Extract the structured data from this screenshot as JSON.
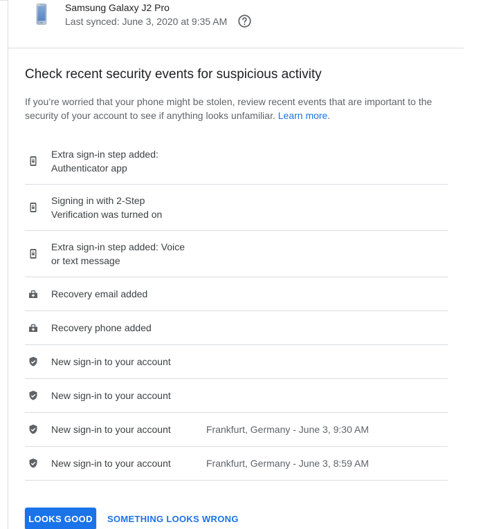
{
  "device": {
    "name": "Samsung Galaxy J2 Pro",
    "last_synced": "Last synced: June 3, 2020 at 9:35 AM",
    "phone_icon": "phone-image",
    "help_icon": "help-circle-icon"
  },
  "security_events": {
    "title": "Check recent security events for suspicious activity",
    "description": "If you’re worried that your phone might be stolen, review recent events that are important to the security of your account to see if anything looks unfamiliar.",
    "learn_more": "Learn more",
    "events": [
      {
        "icon": "phone-lock-icon",
        "label": "Extra sign-in step added: Authenticator app",
        "detail": ""
      },
      {
        "icon": "phone-lock-icon",
        "label": "Signing in with 2-Step Verification was turned on",
        "detail": ""
      },
      {
        "icon": "phone-lock-icon",
        "label": "Extra sign-in step added: Voice or text message",
        "detail": ""
      },
      {
        "icon": "recovery-icon",
        "label": "Recovery email added",
        "detail": ""
      },
      {
        "icon": "recovery-icon",
        "label": "Recovery phone added",
        "detail": ""
      },
      {
        "icon": "shield-check-icon",
        "label": "New sign-in to your account",
        "detail": ""
      },
      {
        "icon": "shield-check-icon",
        "label": "New sign-in to your account",
        "detail": ""
      },
      {
        "icon": "shield-check-icon",
        "label": "New sign-in to your account",
        "detail": "Frankfurt, Germany - June 3, 9:30 AM"
      },
      {
        "icon": "shield-check-icon",
        "label": "New sign-in to your account",
        "detail": "Frankfurt, Germany - June 3, 8:59 AM"
      }
    ]
  },
  "actions": {
    "looks_good": "LOOKS GOOD",
    "looks_wrong": "SOMETHING LOOKS WRONG"
  },
  "colors": {
    "accent": "#1a73e8",
    "icon": "#5f6368",
    "divider": "#dadce0",
    "text_primary": "#202124",
    "text_secondary": "#5f6368"
  }
}
